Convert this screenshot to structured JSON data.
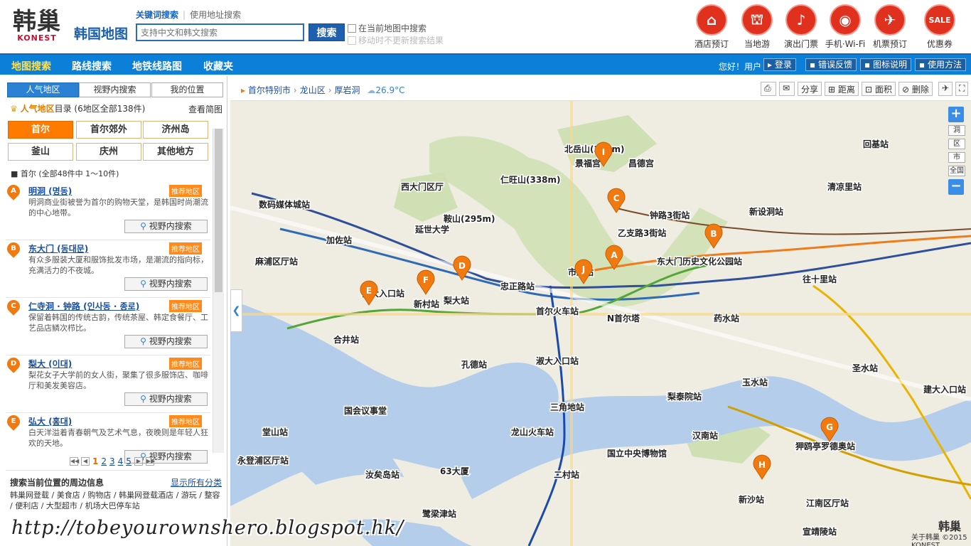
{
  "header": {
    "logo_han": "韩巢",
    "logo_en": "KONEST",
    "map_title": "韩国地图",
    "search_tab_keyword": "关键词搜索",
    "search_tab_address": "使用地址搜索",
    "search_placeholder": "支持中文和韩文搜索",
    "search_button": "搜索",
    "chk_current_map": "在当前地图中搜索",
    "chk_keep_results": "移动时不更新搜索结果",
    "services": [
      {
        "label": "酒店预订",
        "icon": "hotel-icon",
        "glyph": "⌂"
      },
      {
        "label": "当地游",
        "icon": "palace-icon",
        "glyph": "⛫"
      },
      {
        "label": "演出门票",
        "icon": "theater-icon",
        "glyph": "♪"
      },
      {
        "label": "手机·Wi-Fi",
        "icon": "wifi-icon",
        "glyph": "◉"
      },
      {
        "label": "机票预订",
        "icon": "airplane-icon",
        "glyph": "✈"
      },
      {
        "label": "优惠券",
        "icon": "sale-icon",
        "glyph": "SALE"
      }
    ]
  },
  "nav": {
    "items": [
      "地图搜索",
      "路线搜索",
      "地铁线路图",
      "收藏夹"
    ],
    "hello": "您好！用户",
    "login": "登录",
    "feedback": "错误反馈",
    "legend": "图标说明",
    "help": "使用方法"
  },
  "sidebar": {
    "tabs": [
      "人气地区",
      "视野内搜索",
      "我的位置"
    ],
    "region_title_hl": "人气地区",
    "region_title_rest": "目录 (6地区全部138件)",
    "view_simple": "查看简图",
    "regions": [
      "首尔",
      "首尔郊外",
      "济州岛",
      "釜山",
      "庆州",
      "其他地方"
    ],
    "count_text": "■ 首尔 (全部48件中 1～10件)",
    "items": [
      {
        "pin": "A",
        "name": "明洞 (명동)",
        "tag": "推荐地区",
        "desc": "明洞商业街被誉为首尔的购物天堂，是韩国时尚潮流的中心地带。",
        "btn": "视野内搜索"
      },
      {
        "pin": "B",
        "name": "东大门 (동대문)",
        "tag": "推荐地区",
        "desc": "有众多服装大厦和服饰批发市场，是潮流的指向标，充满活力的不夜城。",
        "btn": "视野内搜索"
      },
      {
        "pin": "C",
        "name": "仁寺洞 · 钟路 (인사동 · 종로)",
        "tag": "推荐地区",
        "desc": "保留着韩国的传统古韵，传统茶屋、韩定食餐厅、工艺品店鳞次栉比。",
        "btn": "视野内搜索"
      },
      {
        "pin": "D",
        "name": "梨大 (이대)",
        "tag": "推荐地区",
        "desc": "梨花女子大学前的女人街，聚集了很多服饰店、咖啡厅和美发美容店。",
        "btn": "视野内搜索"
      },
      {
        "pin": "E",
        "name": "弘大 (홍대)",
        "tag": "推荐地区",
        "desc": "白天洋溢着青春朝气及艺术气息，夜晚则是年轻人狂欢的天地。",
        "btn": "视野内搜索"
      }
    ],
    "pager": {
      "current": "1",
      "pages": [
        "2",
        "3",
        "4",
        "5"
      ]
    },
    "nearby_title": "搜索当前位置的周边信息",
    "show_all": "显示所有分类",
    "categories": "韩巢网登载 / 美食店 / 购物店 / 韩巢网登载酒店 / 游玩 / 整容 / 便利店 / 大型超市 / 机场大巴停车站"
  },
  "map": {
    "breadcrumb": [
      "首尔特别市",
      "龙山区",
      "厚岩洞"
    ],
    "temperature": "26.9°C",
    "tools": [
      "分享",
      "距离",
      "面积",
      "删除"
    ],
    "zoom": {
      "in": "+",
      "out": "−",
      "levels": [
        "洞",
        "区",
        "市",
        "全国"
      ]
    },
    "labels": [
      "北岳山(342m)",
      "仁旺山(338m)",
      "鞍山(295m)",
      "景福宫",
      "昌德宫",
      "西大门区厅",
      "延世大学",
      "首尔火车站",
      "N首尔塔",
      "三角地站",
      "龙山火车站",
      "国会议事堂",
      "国立中央博物馆",
      "63大厦",
      "东大门历史文化公园站",
      "弘大入口站",
      "新村站",
      "梨大站",
      "忠正路站",
      "市厅站",
      "乙支路3街站",
      "钟路3街站",
      "清凉里站",
      "往十里站",
      "合井站",
      "汝矣岛站",
      "鹭梁津站",
      "汉南站",
      "狎鸥亭罗德奥站",
      "江南区厅站",
      "宣靖陵站",
      "建大入口站",
      "圣水站",
      "回基站",
      "麻浦区厅站",
      "数码媒体城站",
      "加佐站",
      "孔德站",
      "淑大入口站",
      "梨泰院站",
      "药水站",
      "玉水站",
      "永登浦区厅站",
      "堂山站",
      "新沙站",
      "二村站",
      "新设洞站"
    ],
    "markers": [
      "A",
      "B",
      "C",
      "D",
      "E",
      "F",
      "G",
      "H",
      "I",
      "J"
    ],
    "logo": "韩巢",
    "copyright": "关于韩巢 ©2015 KONEST"
  },
  "watermark": "http://tobeyourownshero.blogspot.hk/"
}
